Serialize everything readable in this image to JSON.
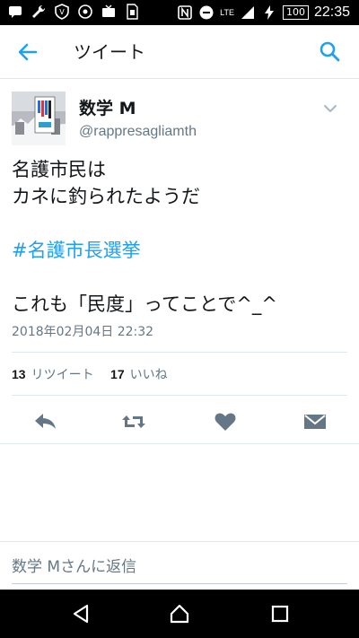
{
  "status_bar": {
    "time": "22:35",
    "battery": "100",
    "network": "LTE",
    "icons": [
      "message-icon",
      "wrench-icon",
      "shield-icon",
      "sync-icon",
      "tv-icon",
      "sim-icon",
      "nfc-icon",
      "minus-circle-icon",
      "signal-icon",
      "charging-icon",
      "battery-icon"
    ]
  },
  "app_bar": {
    "title": "ツイート",
    "back_icon": "arrow-left-icon",
    "search_icon": "search-icon"
  },
  "tweet": {
    "display_name": "数学 M",
    "handle": "@rappresagliamth",
    "lines": [
      "名護市民は",
      "カネに釣られたようだ"
    ],
    "hashtag": "#名護市長選挙",
    "last_line": "これも「民度」ってことで^_^",
    "date": "2018年02月04日 22:32",
    "retweets_count": "13",
    "retweets_label": "リツイート",
    "likes_count": "17",
    "likes_label": "いいね"
  },
  "actions": [
    "reply-icon",
    "retweet-icon",
    "heart-icon",
    "dm-icon"
  ],
  "reply": {
    "placeholder": "数学 Mさんに返信"
  },
  "colors": {
    "accent": "#1da1f2",
    "action_gray": "#657786",
    "text": "#14171a"
  }
}
